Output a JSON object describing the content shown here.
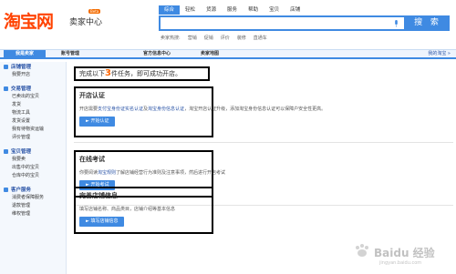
{
  "header": {
    "logo_text": "淘宝网",
    "logo_sub": "卖家中心",
    "logo_beta": "Beta",
    "search_tabs": [
      "综合",
      "轻松",
      "货源",
      "服务",
      "帮助",
      "宝贝",
      "店铺"
    ],
    "search_button": "搜 索",
    "hot_label": "卖家热搜:",
    "hot_words": [
      "营销",
      "促销",
      "评价",
      "装修",
      "直通车"
    ]
  },
  "nav": {
    "items": [
      "我是卖家",
      "账号管理",
      "官方信息中心",
      "卖家地图"
    ],
    "my_taobao": "我的淘宝 »"
  },
  "sidebar": [
    {
      "title": "店铺管理",
      "links": [
        "我要开店"
      ]
    },
    {
      "title": "交易管理",
      "links": [
        "已卖出的宝贝",
        "发货",
        "物流工具",
        "发货设置",
        "我有待物资运输",
        "评价管理"
      ]
    },
    {
      "title": "宝贝管理",
      "links": [
        "我要卖",
        "出售中的宝贝",
        "仓库中的宝贝"
      ]
    },
    {
      "title": "客户服务",
      "links": [
        "消费者保障服务",
        "退款管理",
        "维权管理"
      ]
    }
  ],
  "main": {
    "title_pre": "完成以下",
    "title_num": "3",
    "title_post": "件任务，即可成功开店。",
    "sections": [
      {
        "title": "开店认证",
        "desc_pre": "开店需要",
        "desc_link1": "支付宝身份证实名认证",
        "desc_mid": "及",
        "desc_link2": "淘宝身份信息认证",
        "desc_post": "，淘宝开店认证升级，添加淘宝身份信息认证可以保障户安全性更高。",
        "button": "开始认证"
      },
      {
        "title": "在线考试",
        "desc_pre": "你要阅读",
        "desc_link1": "淘宝规则",
        "desc_mid": "",
        "desc_link2": "",
        "desc_post": "了解店铺经营行为准则及注意事项，然后进行开店考试",
        "button": "开始考试"
      },
      {
        "title": "完善店铺信息",
        "desc_pre": "",
        "desc_link1": "",
        "desc_mid": "",
        "desc_link2": "",
        "desc_post": "填写店铺名称、商品类目，店铺介绍等基本信息",
        "button": "填写店铺信息"
      }
    ]
  },
  "watermark": {
    "text": "Baidu 经验",
    "url": "jingyan.baidu.com"
  },
  "colors": {
    "brand": "#ff4200",
    "accent": "#3f8ae2",
    "link": "#2953a6"
  }
}
